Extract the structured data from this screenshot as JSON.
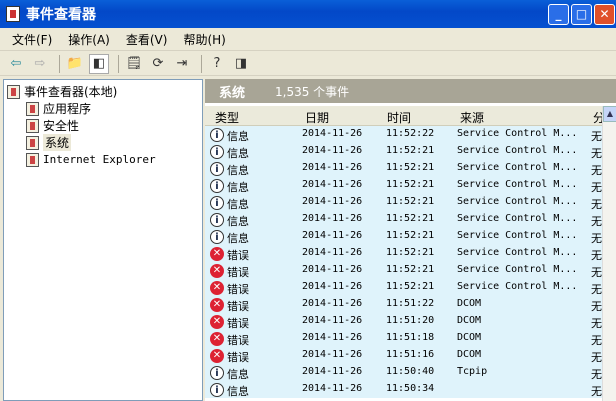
{
  "window": {
    "title": "事件查看器",
    "minimize": "_",
    "maximize": "□",
    "close": "✕"
  },
  "menu": [
    "文件(F)",
    "操作(A)",
    "查看(V)",
    "帮助(H)"
  ],
  "tree": {
    "root": "事件查看器(本地)",
    "items": [
      "应用程序",
      "安全性",
      "系统",
      "Internet Explorer"
    ]
  },
  "panel": {
    "title": "系统",
    "count": "1,535 个事件"
  },
  "columns": [
    "类型",
    "日期",
    "时间",
    "来源",
    "分"
  ],
  "rows": [
    {
      "icon": "info",
      "type": "信息",
      "date": "2014-11-26",
      "time": "11:52:22",
      "source": "Service Control M...",
      "cat": "无"
    },
    {
      "icon": "info",
      "type": "信息",
      "date": "2014-11-26",
      "time": "11:52:21",
      "source": "Service Control M...",
      "cat": "无"
    },
    {
      "icon": "info",
      "type": "信息",
      "date": "2014-11-26",
      "time": "11:52:21",
      "source": "Service Control M...",
      "cat": "无"
    },
    {
      "icon": "info",
      "type": "信息",
      "date": "2014-11-26",
      "time": "11:52:21",
      "source": "Service Control M...",
      "cat": "无"
    },
    {
      "icon": "info",
      "type": "信息",
      "date": "2014-11-26",
      "time": "11:52:21",
      "source": "Service Control M...",
      "cat": "无"
    },
    {
      "icon": "info",
      "type": "信息",
      "date": "2014-11-26",
      "time": "11:52:21",
      "source": "Service Control M...",
      "cat": "无"
    },
    {
      "icon": "info",
      "type": "信息",
      "date": "2014-11-26",
      "time": "11:52:21",
      "source": "Service Control M...",
      "cat": "无"
    },
    {
      "icon": "error",
      "type": "错误",
      "date": "2014-11-26",
      "time": "11:52:21",
      "source": "Service Control M...",
      "cat": "无"
    },
    {
      "icon": "error",
      "type": "错误",
      "date": "2014-11-26",
      "time": "11:52:21",
      "source": "Service Control M...",
      "cat": "无"
    },
    {
      "icon": "error",
      "type": "错误",
      "date": "2014-11-26",
      "time": "11:52:21",
      "source": "Service Control M...",
      "cat": "无"
    },
    {
      "icon": "error",
      "type": "错误",
      "date": "2014-11-26",
      "time": "11:51:22",
      "source": "DCOM",
      "cat": "无"
    },
    {
      "icon": "error",
      "type": "错误",
      "date": "2014-11-26",
      "time": "11:51:20",
      "source": "DCOM",
      "cat": "无"
    },
    {
      "icon": "error",
      "type": "错误",
      "date": "2014-11-26",
      "time": "11:51:18",
      "source": "DCOM",
      "cat": "无"
    },
    {
      "icon": "error",
      "type": "错误",
      "date": "2014-11-26",
      "time": "11:51:16",
      "source": "DCOM",
      "cat": "无"
    },
    {
      "icon": "info",
      "type": "信息",
      "date": "2014-11-26",
      "time": "11:50:40",
      "source": "Tcpip",
      "cat": "无"
    },
    {
      "icon": "info",
      "type": "信息",
      "date": "2014-11-26",
      "time": "11:50:34",
      "source": "",
      "cat": "无"
    }
  ]
}
